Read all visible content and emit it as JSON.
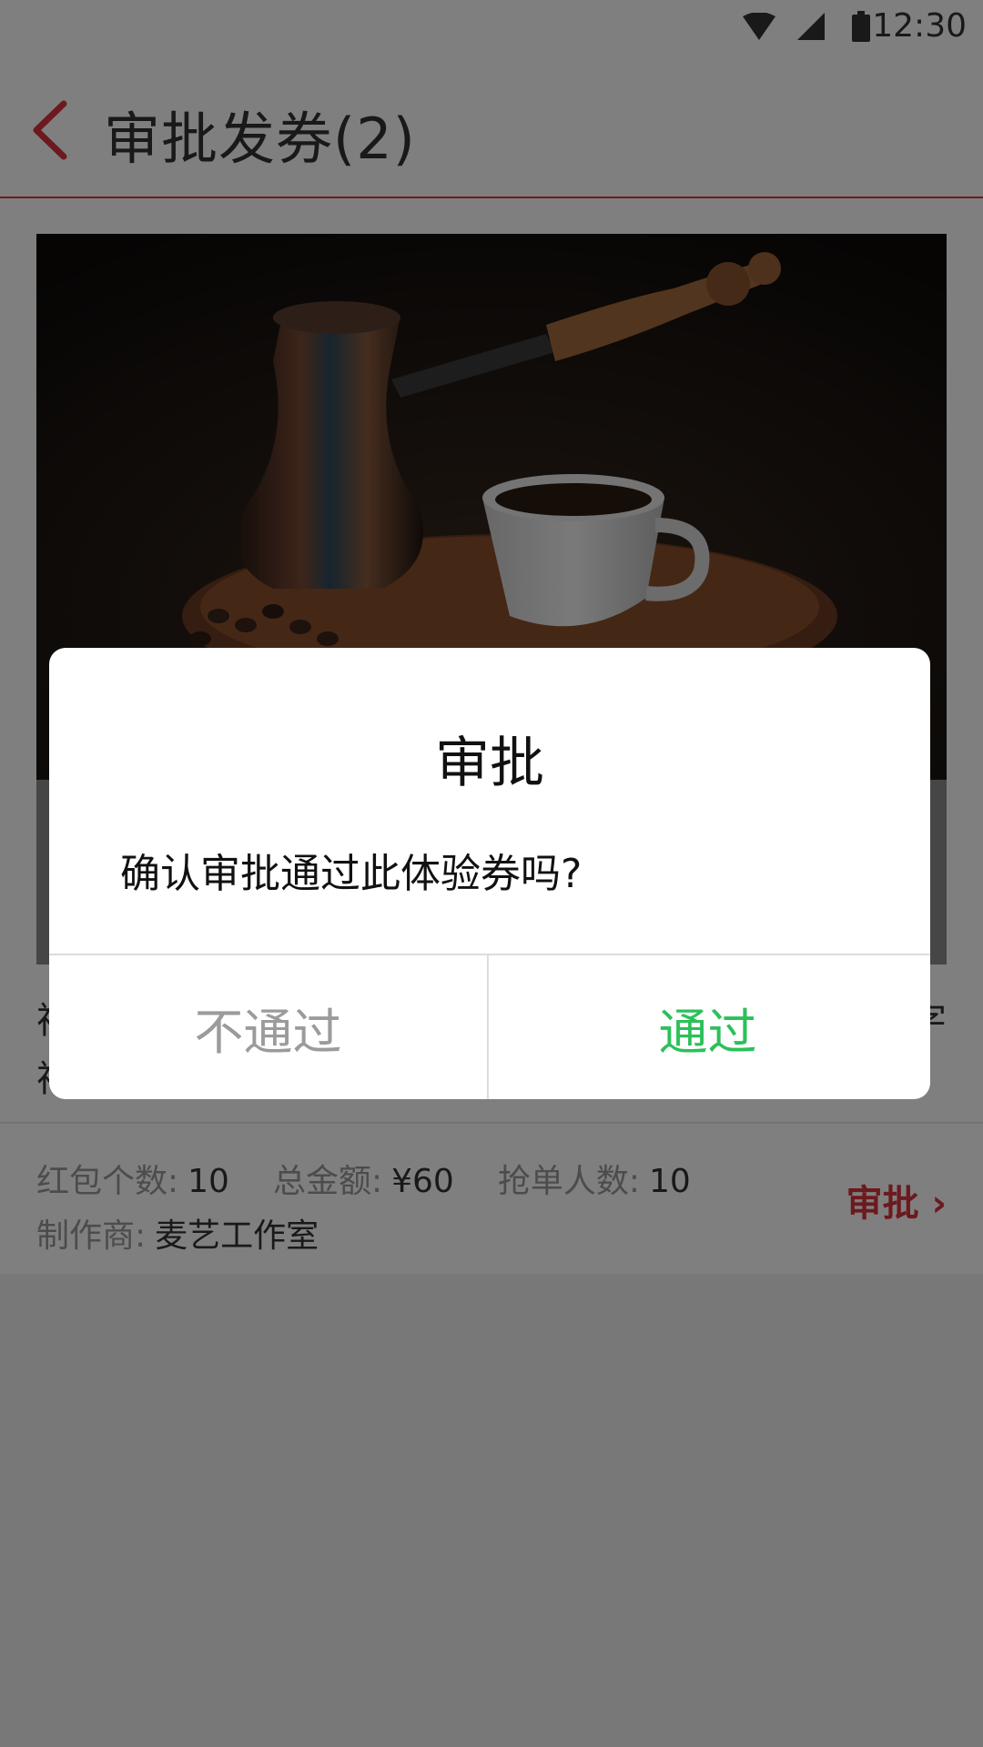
{
  "status_bar": {
    "time": "12:30"
  },
  "header": {
    "title": "审批发券(2)"
  },
  "card": {
    "description_line1": "祥",
    "description_line2": "祥",
    "description_right": "字",
    "meta": {
      "count_label": "红包个数:",
      "count_value": "10",
      "amount_label": "总金额:",
      "amount_value": "¥60",
      "grab_label": "抢单人数:",
      "grab_value": "10",
      "maker_label": "制作商:",
      "maker_value": "麦艺工作室"
    },
    "approve_link": "审批 ›"
  },
  "dialog": {
    "title": "审批",
    "message": "确认审批通过此体验券吗?",
    "reject_label": "不通过",
    "pass_label": "通过"
  },
  "colors": {
    "accent": "#d9333f",
    "pass": "#2cc05a",
    "reject": "#9b9b9b"
  }
}
